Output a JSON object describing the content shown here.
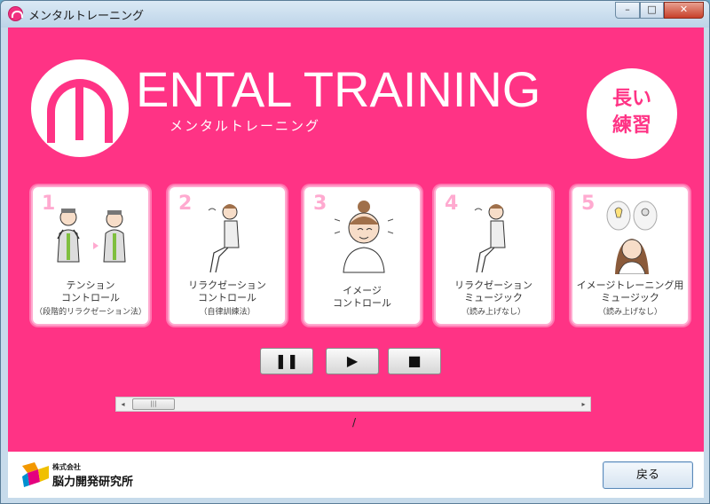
{
  "window": {
    "title": "メンタルトレーニング",
    "min": "–",
    "max": "□",
    "close": "✕"
  },
  "header": {
    "logo_text": "ENTAL TRAINING",
    "logo_sub": "メンタルトレーニング",
    "mode_line1": "長い",
    "mode_line2": "練習"
  },
  "cards": [
    {
      "num": "1",
      "title1": "テンション",
      "title2": "コントロール",
      "note": "（段階的リラクゼーション法）"
    },
    {
      "num": "2",
      "title1": "リラクゼーション",
      "title2": "コントロール",
      "note": "（自律訓練法）"
    },
    {
      "num": "3",
      "title1": "イメージ",
      "title2": "コントロール",
      "note": ""
    },
    {
      "num": "4",
      "title1": "リラクゼーション",
      "title2": "ミュージック",
      "note": "（読み上げなし）"
    },
    {
      "num": "5",
      "title1": "イメージトレーニング用",
      "title2": "ミュージック",
      "note": "（読み上げなし）"
    }
  ],
  "player": {
    "pause": "❚❚",
    "play": "▶",
    "stop": "■",
    "time": "/",
    "scroll_left": "◂",
    "scroll_right": "▸",
    "thumb_grip": "|||"
  },
  "footer": {
    "company_small": "株式会社",
    "company_name": "脳力開発研究所",
    "back_label": "戻る"
  },
  "colors": {
    "brand_pink": "#ff3385",
    "card_border": "#ffaad0"
  }
}
